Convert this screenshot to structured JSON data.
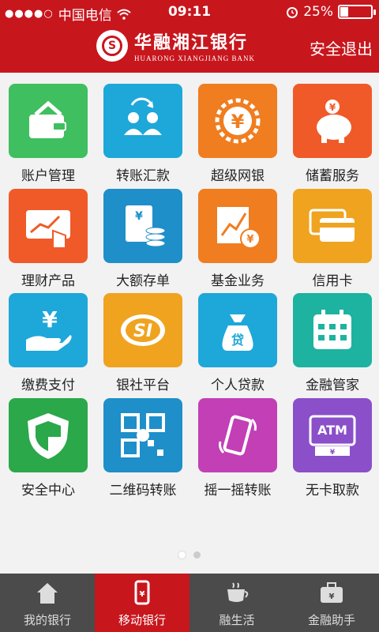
{
  "status_bar": {
    "carrier": "中国电信",
    "time": "09:11",
    "battery_text": "25%",
    "battery_level": 0.25
  },
  "header": {
    "logo_letter": "S",
    "bank_name_cn": "华融湘江银行",
    "bank_name_en": "HUARONG XIANGJIANG BANK",
    "logout_label": "安全退出"
  },
  "tiles": [
    {
      "label": "账户管理",
      "icon": "wallet-icon",
      "color": "#3fbf5f"
    },
    {
      "label": "转账汇款",
      "icon": "transfer-people-icon",
      "color": "#1ea7d9"
    },
    {
      "label": "超级网银",
      "icon": "yuan-coin-icon",
      "color": "#f07d1f"
    },
    {
      "label": "储蓄服务",
      "icon": "piggy-bank-icon",
      "color": "#f05a28"
    },
    {
      "label": "理财产品",
      "icon": "finance-chart-icon",
      "color": "#f05a28"
    },
    {
      "label": "大额存单",
      "icon": "deposit-certificate-icon",
      "color": "#1e8fc9"
    },
    {
      "label": "基金业务",
      "icon": "fund-chart-icon",
      "color": "#f07d1f"
    },
    {
      "label": "信用卡",
      "icon": "credit-card-icon",
      "color": "#f0a31f"
    },
    {
      "label": "缴费支付",
      "icon": "payment-hand-icon",
      "color": "#1ea7d9"
    },
    {
      "label": "银社平台",
      "icon": "si-logo-icon",
      "color": "#f0a31f"
    },
    {
      "label": "个人贷款",
      "icon": "loan-bag-icon",
      "color": "#1ea7d9"
    },
    {
      "label": "金融管家",
      "icon": "calendar-icon",
      "color": "#1db3a0"
    },
    {
      "label": "安全中心",
      "icon": "shield-icon",
      "color": "#2aa84a"
    },
    {
      "label": "二维码转账",
      "icon": "qr-code-icon",
      "color": "#1e8fc9"
    },
    {
      "label": "摇一摇转账",
      "icon": "shake-phone-icon",
      "color": "#c23fb6"
    },
    {
      "label": "无卡取款",
      "icon": "atm-icon",
      "color": "#8a4fc9"
    }
  ],
  "tabbar": [
    {
      "label": "我的银行",
      "icon": "home-icon",
      "active": false
    },
    {
      "label": "移动银行",
      "icon": "mobile-bank-icon",
      "active": true
    },
    {
      "label": "融生活",
      "icon": "coffee-cup-icon",
      "active": false
    },
    {
      "label": "金融助手",
      "icon": "briefcase-icon",
      "active": false
    }
  ]
}
